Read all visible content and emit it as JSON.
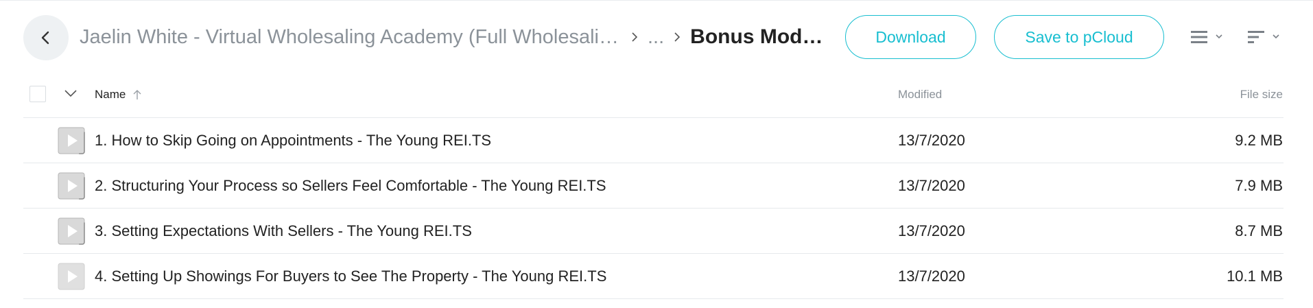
{
  "header": {
    "breadcrumb": {
      "root": "Jaelin White - Virtual Wholesaling Academy (Full Wholesaling Course)",
      "middle": "...",
      "current": "Bonus Modules"
    },
    "download_label": "Download",
    "save_label": "Save to pCloud"
  },
  "table": {
    "columns": {
      "name": "Name",
      "modified": "Modified",
      "size": "File size"
    },
    "rows": [
      {
        "name": "1. How to Skip Going on Appointments - The Young REI.TS",
        "modified": "13/7/2020",
        "size": "9.2 MB"
      },
      {
        "name": "2. Structuring Your Process so Sellers Feel Comfortable - The Young REI.TS",
        "modified": "13/7/2020",
        "size": "7.9 MB"
      },
      {
        "name": "3. Setting Expectations With Sellers - The Young REI.TS",
        "modified": "13/7/2020",
        "size": "8.7 MB"
      },
      {
        "name": "4. Setting Up Showings For Buyers to See The Property - The Young REI.TS",
        "modified": "13/7/2020",
        "size": "10.1 MB"
      }
    ]
  },
  "icons": {
    "back": "chevron-left-icon",
    "breadcrumb_separator": "chevron-right-icon",
    "list_view": "list-view-icon",
    "sort": "sort-icon",
    "file": "video-file-icon"
  },
  "colors": {
    "accent": "#17bed0",
    "muted_text": "#8b9299",
    "primary_text": "#222222",
    "divider": "#e6e9ec"
  }
}
